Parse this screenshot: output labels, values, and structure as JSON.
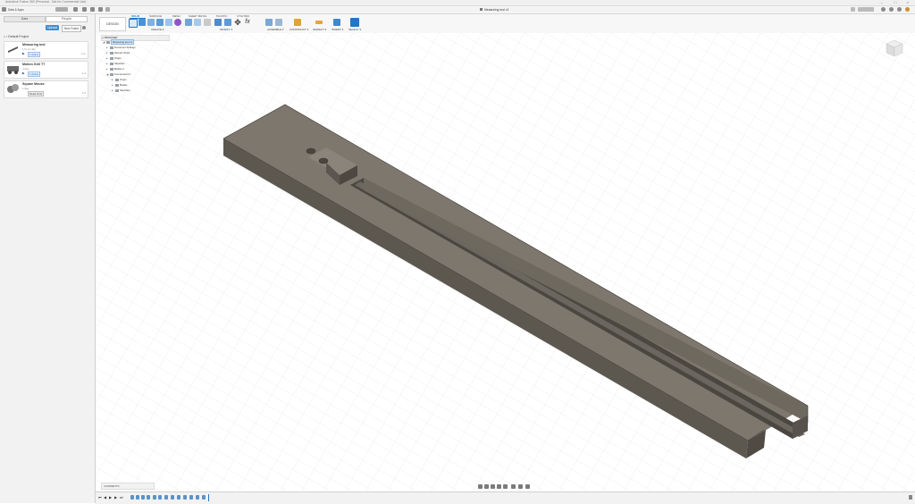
{
  "window": {
    "title": "Autodesk Fusion 360 (Personal - Not for Commercial Use)"
  },
  "app_bar": {
    "team": "Data & Apps",
    "document_tab": "Measuring tool v1"
  },
  "data_panel": {
    "tabs": [
      {
        "label": "Data"
      },
      {
        "label": "People"
      }
    ],
    "upload_label": "Upload",
    "new_folder_label": "New Folder",
    "project_label": "Default Project",
    "files": [
      {
        "name": "Measuring tool",
        "subtitle": "1 hr 11 day",
        "version": "1 Active",
        "side": "1 m"
      },
      {
        "name": "Motion Grill TT",
        "subtitle": "4 day",
        "version": "1 Active",
        "side": "1 d"
      },
      {
        "name": "Square Mouse",
        "subtitle": "1 day",
        "version": "Read Only",
        "side": "1 d"
      }
    ]
  },
  "toolbar": {
    "workspace": "DESIGN",
    "tabs": [
      {
        "label": "SOLID",
        "active": true
      },
      {
        "label": "SURFACE",
        "active": false
      },
      {
        "label": "MESH",
        "active": false
      },
      {
        "label": "SHEET METAL",
        "active": false
      },
      {
        "label": "PLASTIC",
        "active": false
      },
      {
        "label": "UTILITIES",
        "active": false
      }
    ],
    "groups": [
      {
        "label": "CREATE ▾"
      },
      {
        "label": "MODIFY ▾"
      },
      {
        "label": "ASSEMBLE ▾"
      },
      {
        "label": "CONSTRUCT ▾"
      },
      {
        "label": "INSPECT ▾"
      },
      {
        "label": "INSERT ▾"
      },
      {
        "label": "SELECT ▾"
      }
    ]
  },
  "browser": {
    "header": "BROWSER",
    "root": "Measuring tool v1",
    "items": [
      {
        "label": "Document Settings",
        "level": 1
      },
      {
        "label": "Named Views",
        "level": 1
      },
      {
        "label": "Origin",
        "level": 1
      },
      {
        "label": "Sketches",
        "level": 1
      },
      {
        "label": "Bodies:1",
        "level": 1
      },
      {
        "label": "Component1:1",
        "level": 1
      },
      {
        "label": "Origin",
        "level": 2
      },
      {
        "label": "Bodies",
        "level": 2
      },
      {
        "label": "Sketches",
        "level": 2
      }
    ]
  },
  "comments": {
    "label": "COMMENTS"
  },
  "colors": {
    "accent": "#1f77c9",
    "body_top": "#7d776e",
    "body_side": "#5c574f",
    "body_dark": "#4a4640"
  }
}
